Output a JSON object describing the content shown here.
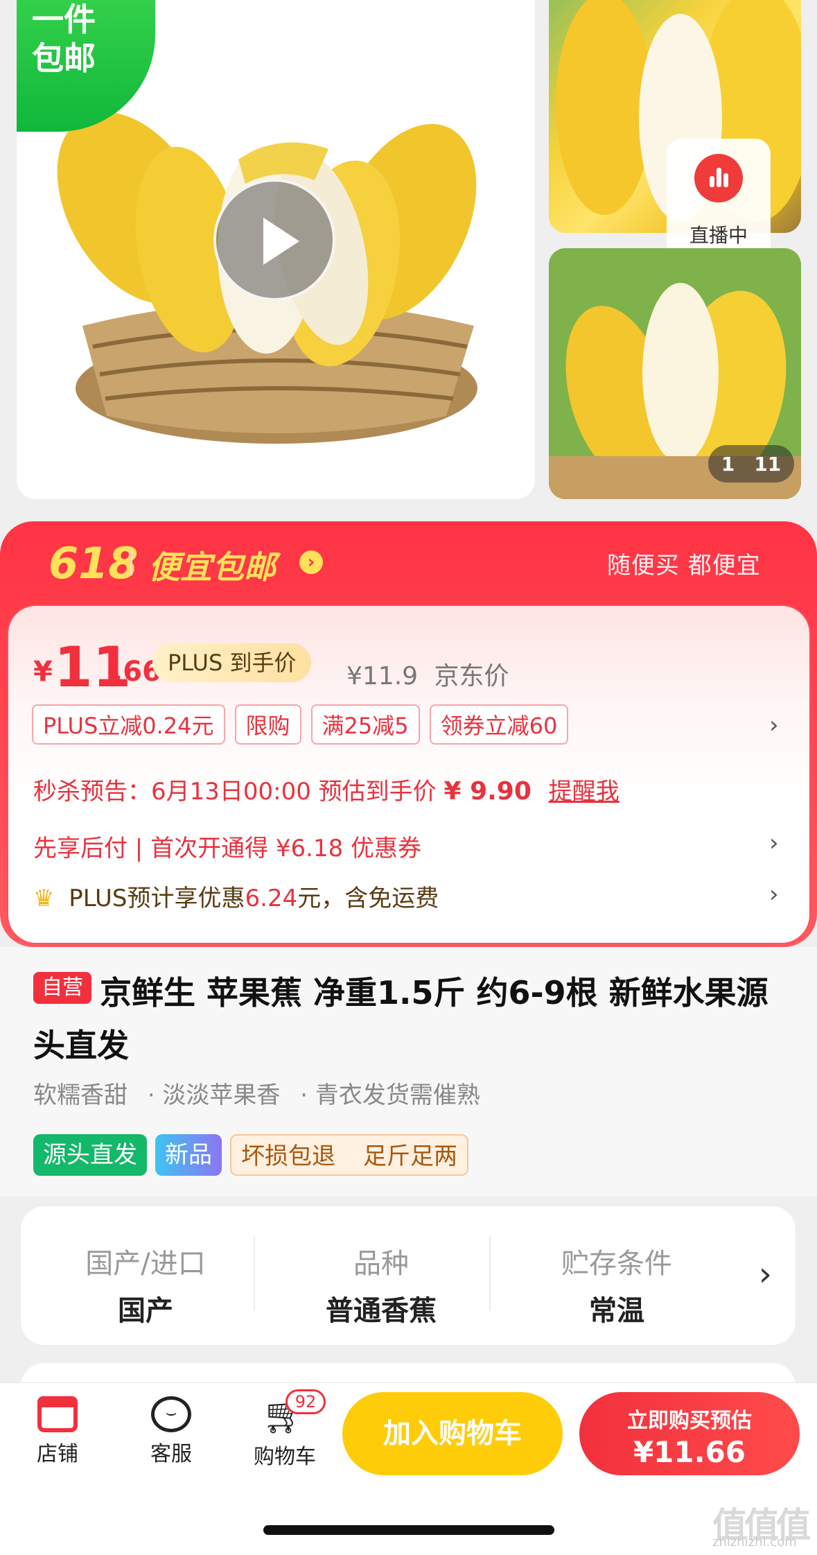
{
  "gallery": {
    "free_shipping_line1": "一件",
    "free_shipping_line2": "包邮",
    "live_label": "直播中",
    "counter_current": "1",
    "counter_total": "11"
  },
  "promo": {
    "event": "618",
    "title": "便宜包邮",
    "slogan": "随便买 都便宜"
  },
  "price": {
    "currency": "¥",
    "integer": "11",
    "decimal": ".66",
    "plus_label": "PLUS 到手价",
    "jd_price": "¥11.9",
    "jd_label": "京东价",
    "tags": [
      "PLUS立减0.24元",
      "限购",
      "满25减5",
      "领券立减60"
    ],
    "flash_sale_prefix": "秒杀预告：6月13日00:00 预估到手价",
    "flash_sale_price": "¥ 9.90",
    "flash_remind": "提醒我",
    "pay_later": "先享后付 | 首次开通得 ¥6.18 优惠券",
    "plus_prefix": "PLUS预计享优惠",
    "plus_amount": "6.24",
    "plus_suffix": "元，含免运费"
  },
  "product": {
    "self_tag": "自营",
    "title": "京鲜生 苹果蕉 净重1.5斤 约6-9根 新鲜水果源头直发",
    "selling_points": [
      "软糯香甜",
      "· 淡淡苹果香",
      "· 青衣发货需催熟"
    ],
    "service_tags": {
      "source": "源头直发",
      "new": "新品",
      "damage": "坏损包退",
      "weight": "足斤足两"
    }
  },
  "specs": [
    {
      "label": "国产/进口",
      "value": "国产"
    },
    {
      "label": "品种",
      "value": "普通香蕉"
    },
    {
      "label": "贮存条件",
      "value": "常温"
    }
  ],
  "bottom_bar": {
    "store": "店铺",
    "service": "客服",
    "cart": "购物车",
    "cart_count": "92",
    "add_to_cart": "加入购物车",
    "buy_now_line1": "立即购买预估",
    "buy_now_line2": "¥11.66"
  },
  "watermark": {
    "logo": "值值值",
    "domain": "zhizhizhi.com"
  },
  "colors": {
    "brand_red": "#f2303d",
    "add_to_cart_yellow": "#ffcc0a",
    "promo_gold": "#ffe25a",
    "service_green": "#13b86b"
  }
}
